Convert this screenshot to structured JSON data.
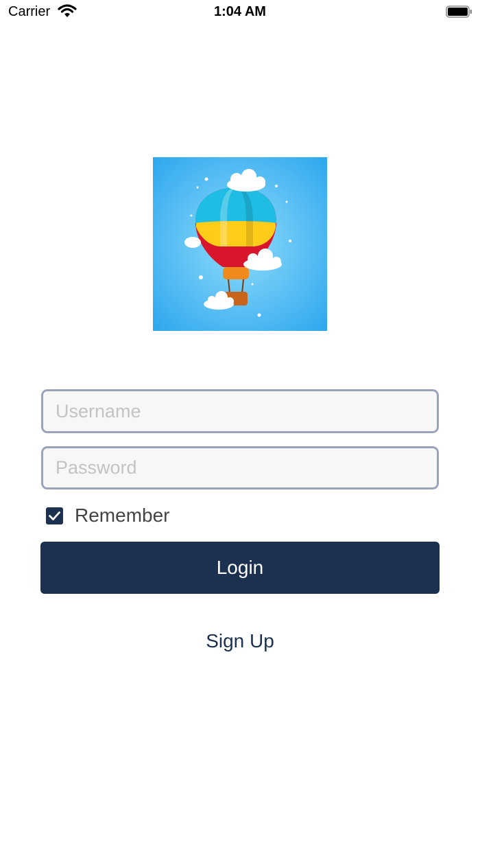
{
  "status_bar": {
    "carrier": "Carrier",
    "time": "1:04 AM"
  },
  "login_form": {
    "username_placeholder": "Username",
    "password_placeholder": "Password",
    "remember_label": "Remember",
    "remember_checked": true,
    "login_label": "Login",
    "signup_label": "Sign Up"
  },
  "colors": {
    "primary": "#1b314f",
    "field_border": "#9aa3b8",
    "field_background": "#f7f7f7"
  },
  "icons": [
    "wifi-icon",
    "battery-icon",
    "balloon-logo",
    "checkmark-icon"
  ]
}
